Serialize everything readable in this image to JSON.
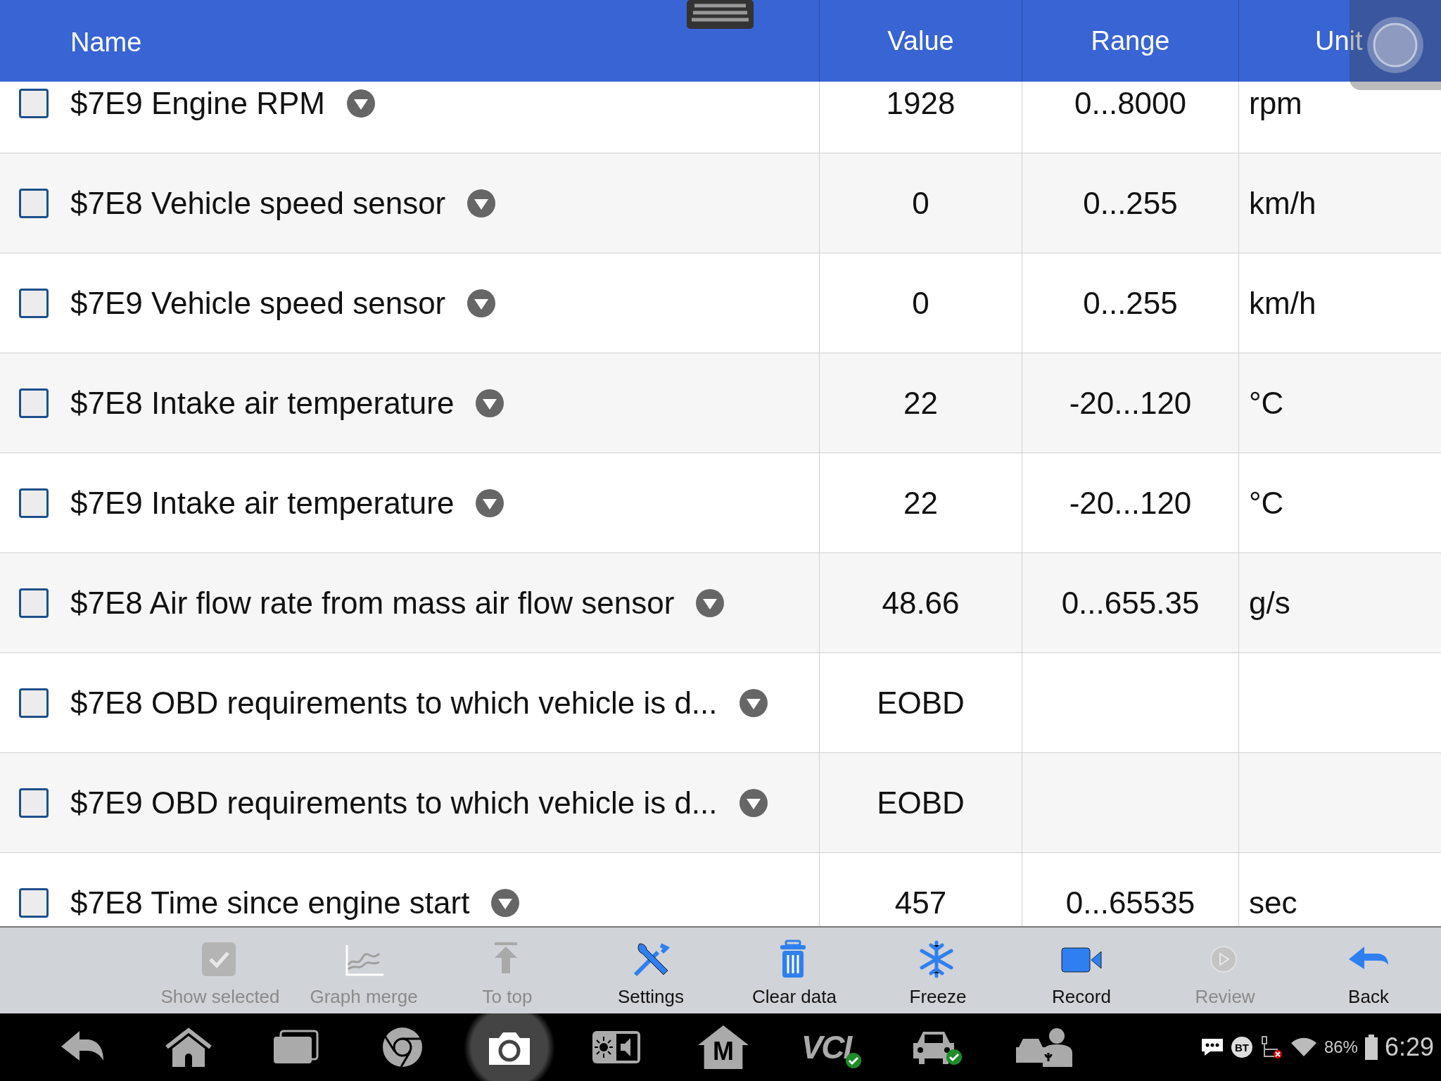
{
  "header": {
    "columns": [
      "Name",
      "Value",
      "Range",
      "Unit"
    ]
  },
  "rows": [
    {
      "name": "$7E9 Engine RPM",
      "value": "1928",
      "range": "0...8000",
      "unit": "rpm",
      "checked": false
    },
    {
      "name": "$7E8 Vehicle speed sensor",
      "value": "0",
      "range": "0...255",
      "unit": "km/h",
      "checked": false
    },
    {
      "name": "$7E9 Vehicle speed sensor",
      "value": "0",
      "range": "0...255",
      "unit": "km/h",
      "checked": false
    },
    {
      "name": "$7E8 Intake air temperature",
      "value": "22",
      "range": "-20...120",
      "unit": "°C",
      "checked": false
    },
    {
      "name": "$7E9 Intake air temperature",
      "value": "22",
      "range": "-20...120",
      "unit": "°C",
      "checked": false
    },
    {
      "name": "$7E8 Air flow rate from mass air flow sensor",
      "value": "48.66",
      "range": "0...655.35",
      "unit": "g/s",
      "checked": false
    },
    {
      "name": "$7E8 OBD requirements to which vehicle is d...",
      "value": "EOBD",
      "checked": false
    },
    {
      "name": "$7E9 OBD requirements to which vehicle is d...",
      "value": "EOBD",
      "checked": false
    },
    {
      "name": "$7E8 Time since engine start",
      "value": "457",
      "range": "0...65535",
      "unit": "sec",
      "checked": false
    }
  ],
  "toolbar": [
    {
      "kind": "check",
      "label": "Show selected",
      "disabled": true
    },
    {
      "kind": "graph",
      "label": "Graph merge",
      "disabled": true
    },
    {
      "kind": "totop",
      "label": "To top",
      "disabled": true
    },
    {
      "kind": "tools",
      "label": "Settings",
      "disabled": false
    },
    {
      "kind": "trash",
      "label": "Clear data",
      "disabled": false
    },
    {
      "kind": "snow",
      "label": "Freeze",
      "disabled": false
    },
    {
      "kind": "camera",
      "label": "Record",
      "disabled": false
    },
    {
      "kind": "play",
      "label": "Review",
      "disabled": true
    },
    {
      "kind": "back",
      "label": "Back",
      "disabled": false
    }
  ],
  "system_bar": {
    "apps": [
      {
        "kind": "back"
      },
      {
        "kind": "home"
      },
      {
        "kind": "recents"
      },
      {
        "kind": "browser"
      },
      {
        "kind": "camera",
        "selected": true
      },
      {
        "kind": "display"
      },
      {
        "kind": "house-m",
        "text": "M"
      },
      {
        "kind": "vci",
        "text": "VCI"
      },
      {
        "kind": "car"
      },
      {
        "kind": "service"
      }
    ],
    "bluetooth": "BT",
    "battery": "86%",
    "time": "6:29"
  }
}
